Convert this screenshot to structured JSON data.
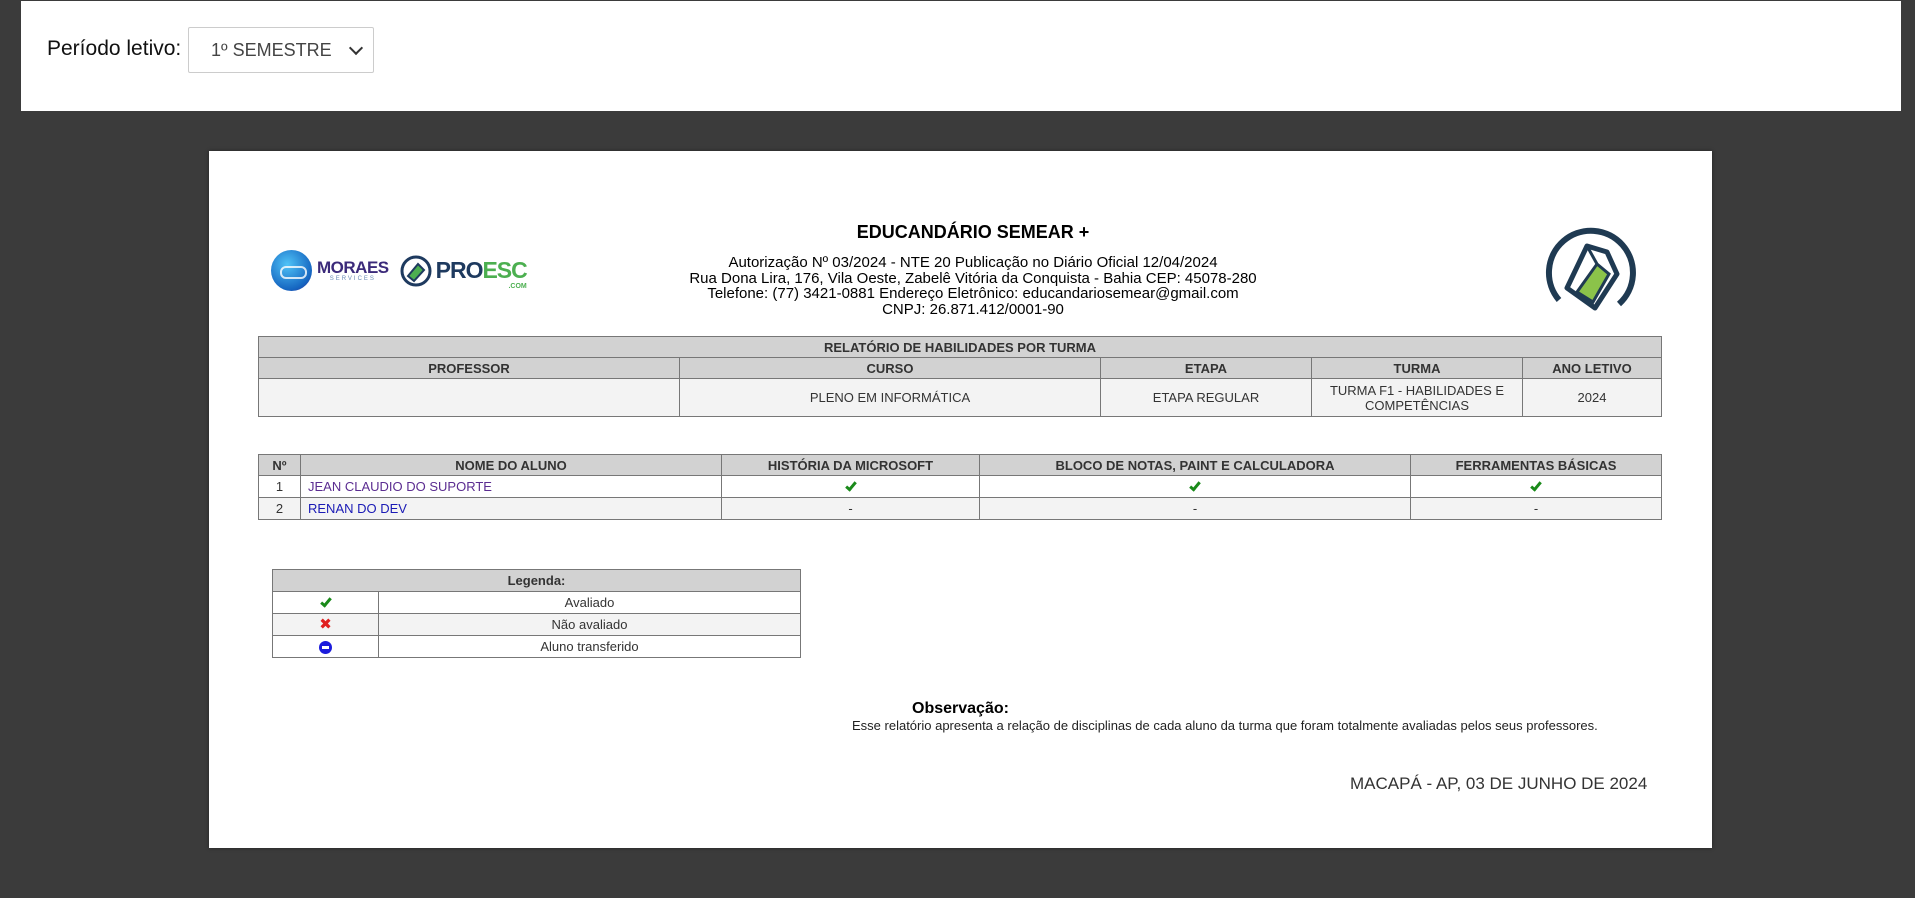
{
  "filter": {
    "label": "Período letivo:",
    "selected": "1º SEMESTRE"
  },
  "logos": {
    "moraes": {
      "name": "MORAES",
      "sub": "SERVICES"
    },
    "proesc": {
      "pro": "PRO",
      "esc": "ESC",
      "com": ".COM"
    }
  },
  "school": {
    "name": "EDUCANDÁRIO SEMEAR +",
    "authorization": "Autorização Nº 03/2024 - NTE 20 Publicação no Diário Oficial 12/04/2024",
    "address": "Rua Dona Lira, 176, Vila Oeste, Zabelê Vitória da Conquista - Bahia CEP: 45078-280",
    "contact": "Telefone: (77) 3421-0881 Endereço Eletrônico: educandariosemear@gmail.com",
    "cnpj": "CNPJ: 26.871.412/0001-90"
  },
  "report": {
    "title": "RELATÓRIO DE HABILIDADES POR TURMA",
    "headers": {
      "professor": "PROFESSOR",
      "curso": "CURSO",
      "etapa": "ETAPA",
      "turma": "TURMA",
      "ano": "ANO LETIVO"
    },
    "values": {
      "professor": "",
      "curso": "PLENO EM INFORMÁTICA",
      "etapa": "ETAPA REGULAR",
      "turma": "TURMA F1 - HABILIDADES E COMPETÊNCIAS",
      "ano": "2024"
    }
  },
  "students": {
    "headers": [
      "Nº",
      "NOME DO ALUNO",
      "HISTÓRIA DA MICROSOFT",
      "BLOCO DE NOTAS, PAINT E CALCULADORA",
      "FERRAMENTAS BÁSICAS"
    ],
    "rows": [
      {
        "n": "1",
        "name": "JEAN CLAUDIO DO SUPORTE",
        "marks": [
          "check-icon",
          "check-icon",
          "check-icon"
        ]
      },
      {
        "n": "2",
        "name": "RENAN DO DEV",
        "marks": [
          "-",
          "-",
          "-"
        ]
      }
    ]
  },
  "legend": {
    "title": "Legenda:",
    "items": [
      {
        "icon": "check-icon",
        "label": "Avaliado"
      },
      {
        "icon": "cross-icon",
        "label": "Não avaliado"
      },
      {
        "icon": "minus-circle-icon",
        "label": "Aluno transferido"
      }
    ]
  },
  "observation": {
    "title": "Observação:",
    "text": "Esse relatório apresenta a relação de disciplinas de cada aluno da turma que foram totalmente avaliadas pelos seus professores."
  },
  "place_date": "MACAPÁ - AP, 03 DE JUNHO DE 2024",
  "colors": {
    "background": "#3b3b3b",
    "header_cell": "#d2d2d2",
    "check": "#1a8a1a",
    "cross": "#e02020",
    "transferred": "#1c1cdc"
  }
}
